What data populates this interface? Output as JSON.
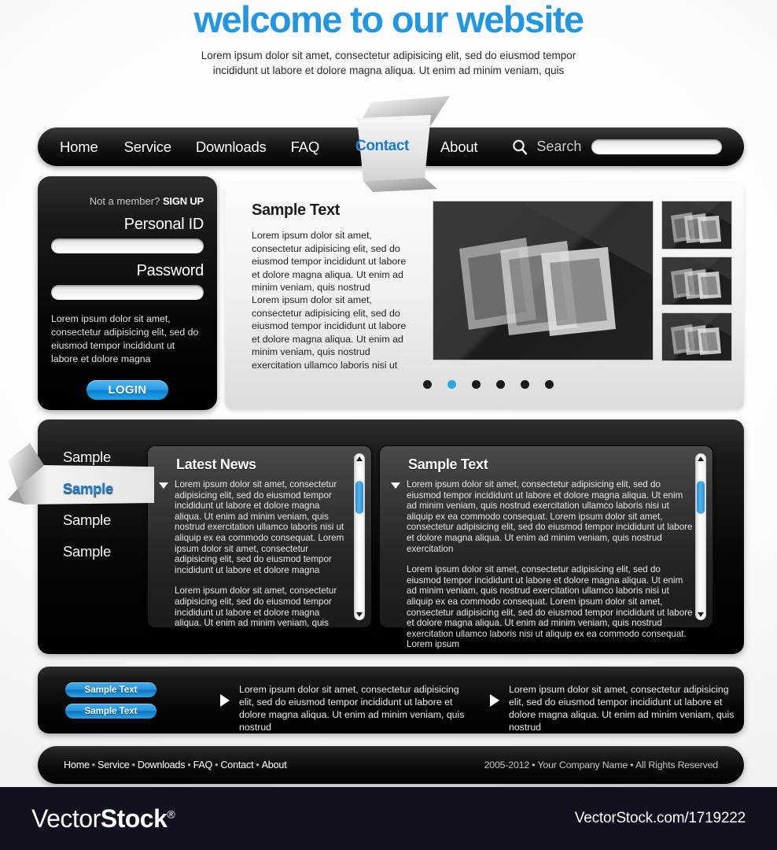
{
  "hero": {
    "title": "welcome to our website",
    "subtitle": "Lorem ipsum dolor sit amet, consectetur adipisicing elit, sed do eiusmod tempor incididunt ut labore et dolore magna aliqua. Ut enim ad minim veniam, quis"
  },
  "colors": {
    "accent_blue": "#2196e3",
    "contact_blue": "#1878cf",
    "active_link_blue": "#1d7fd4",
    "dot_active": "#29a8e0",
    "dark_panel": "#000000",
    "watermark_bg": "#11121f"
  },
  "nav": {
    "items": [
      {
        "label": "Home",
        "active": false
      },
      {
        "label": "Service",
        "active": false
      },
      {
        "label": "Downloads",
        "active": false
      },
      {
        "label": "FAQ",
        "active": false
      },
      {
        "label": "Contact",
        "active": true
      },
      {
        "label": "About",
        "active": false
      }
    ],
    "search": {
      "label": "Search",
      "icon": "search-icon",
      "value": "",
      "placeholder": ""
    }
  },
  "login": {
    "prompt": "Not a member?",
    "signup_label": "SIGN UP",
    "personal_id_label": "Personal ID",
    "personal_id_value": "",
    "password_label": "Password",
    "password_value": "",
    "blurb": "Lorem ipsum dolor sit amet, consectetur adipisicing elit, sed do eiusmod tempor incididunt ut labore et dolore magna",
    "login_button": "LOGIN"
  },
  "content": {
    "heading": "Sample Text",
    "paragraph_1": "Lorem ipsum dolor sit amet, consectetur adipisicing elit, sed do eiusmod tempor incididunt ut labore et dolore magna aliqua. Ut enim ad minim veniam, quis nostrud",
    "paragraph_2": "Lorem ipsum dolor sit amet, consectetur adipisicing elit, sed do eiusmod tempor incididunt ut labore et dolore magna aliqua. Ut enim ad minim veniam, quis nostrud exercitation ullamco laboris nisi ut",
    "gallery": {
      "main_image_alt": "stacked-frames-image",
      "thumbnails": [
        "stacked-frames-thumb",
        "stacked-frames-thumb",
        "stacked-frames-thumb"
      ],
      "dots_total": 6,
      "dot_active_index": 2
    }
  },
  "side_links": [
    {
      "label": "Sample",
      "active": false
    },
    {
      "label": "Sample",
      "active": true
    },
    {
      "label": "Sample",
      "active": false
    },
    {
      "label": "Sample",
      "active": false
    }
  ],
  "panels": [
    {
      "heading": "Latest News",
      "paragraphs": [
        "Lorem ipsum dolor sit amet, consectetur adipisicing elit, sed do eiusmod tempor incididunt ut labore et dolore magna aliqua. Ut enim ad minim veniam, quis nostrud exercitation ullamco laboris nisi ut aliquip ex ea commodo consequat. Lorem ipsum dolor sit amet, consectetur adipisicing elit, sed do eiusmod tempor incididunt ut labore et dolore magna",
        "Lorem ipsum dolor sit amet, consectetur adipisicing elit, sed do eiusmod tempor incididunt ut labore et dolore magna aliqua. Ut enim ad minim veniam, quis"
      ]
    },
    {
      "heading": "Sample Text",
      "paragraphs": [
        "Lorem ipsum dolor sit amet, consectetur adipisicing elit, sed do eiusmod tempor incididunt ut labore et dolore magna aliqua. Ut enim ad minim veniam, quis nostrud exercitation ullamco laboris nisi ut aliquip ex ea commodo consequat. Lorem ipsum dolor sit amet, consectetur adipisicing elit, sed do eiusmod tempor incididunt ut labore et dolore magna aliqua. Ut enim ad minim veniam, quis nostrud exercitation",
        "Lorem ipsum dolor sit amet, consectetur adipisicing elit, sed do eiusmod tempor incididunt ut labore et dolore magna aliqua. Ut enim ad minim veniam, quis nostrud exercitation ullamco laboris nisi ut aliquip ex ea commodo consequat. Lorem ipsum dolor sit amet, consectetur adipisicing elit, sed do eiusmod tempor incididunt ut labore et dolore magna aliqua. Ut enim ad minim veniam, quis nostrud exercitation ullamco laboris nisi ut aliquip ex ea commodo consequat. Lorem ipsum"
      ]
    }
  ],
  "promo": {
    "buttons": [
      "Sample Text",
      "Sample Text"
    ],
    "blocks": [
      "Lorem ipsum dolor sit amet, consectetur adipisicing elit, sed do eiusmod tempor incididunt ut labore et dolore magna aliqua. Ut enim ad minim veniam, quis nostrud",
      "Lorem ipsum dolor sit amet, consectetur adipisicing elit, sed do eiusmod tempor incididunt ut labore et dolore magna aliqua. Ut enim ad minim veniam, quis nostrud"
    ]
  },
  "footer": {
    "links": [
      "Home",
      "Service",
      "Downloads",
      "FAQ",
      "Contact",
      "About"
    ],
    "separator": "•",
    "copyright": "2005-2012 • Your Company Name • All Rights Reserved"
  },
  "watermark": {
    "logo_light": "Vector",
    "logo_bold": "Stock",
    "registered": "®",
    "url": "VectorStock.com/1719222"
  }
}
